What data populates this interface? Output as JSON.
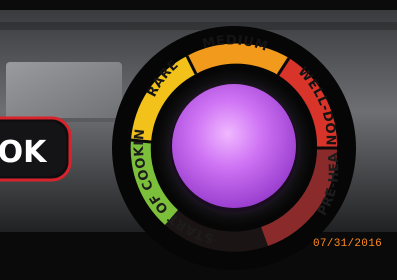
{
  "button": {
    "ok_label": "OK"
  },
  "dial": {
    "labels": {
      "rare": "RARE",
      "medium": "MEDIUM",
      "well_done": "WELL-DONE",
      "pre_heating": "PRE-HEATING",
      "start_of_cooking": "START OF COOKING"
    },
    "zone_colors": {
      "start_of_cooking": "#7bbf3a",
      "rare": "#f2c21b",
      "medium": "#f29a1b",
      "well_done": "#d8342a",
      "pre_heating": "#8b2a2a"
    },
    "center_light_color": "#c86bf0"
  },
  "photo": {
    "date_stamp": "07/31/2016"
  }
}
